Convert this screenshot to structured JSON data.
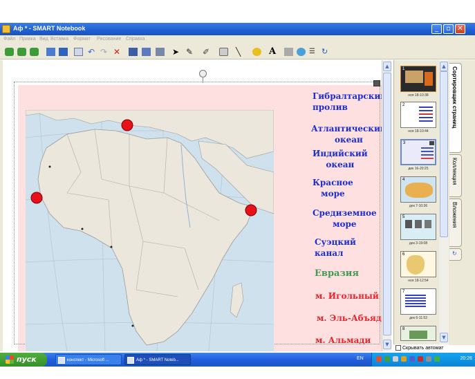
{
  "window": {
    "title": "Аф * - SMART Notebook",
    "min_glyph": "_",
    "max_glyph": "▫",
    "close_glyph": "✕"
  },
  "menu": [
    "Файл",
    "Правка",
    "Вид",
    "Вставка",
    "Формат",
    "Рисование",
    "Справка"
  ],
  "labels": {
    "gibraltar": [
      "Гибралтарский",
      "пролив"
    ],
    "atlantic": [
      "Атлантический",
      "океан"
    ],
    "indian": [
      "Индийский",
      "океан"
    ],
    "red_sea": [
      "Красное",
      "море"
    ],
    "mediterranean": [
      "Средиземное",
      "море"
    ],
    "suez": [
      "Суэцкий",
      "канал"
    ],
    "eurasia": "Евразия",
    "cape_agulhas": "м. Игольный",
    "cape_ben_sekka": "м. Эль-Абъяд",
    "cape_almadi": "м. Альмади"
  },
  "sorter": {
    "pages": [
      {
        "num": "1",
        "caption": "ноя 18-10:38"
      },
      {
        "num": "2",
        "caption": "ноя 18-10:44"
      },
      {
        "num": "3",
        "caption": "дек 16-20:25"
      },
      {
        "num": "4",
        "caption": "дек 7-10:36"
      },
      {
        "num": "5",
        "caption": "дек 3-19:08"
      },
      {
        "num": "6",
        "caption": "ноя 18-12:54"
      },
      {
        "num": "7",
        "caption": "дек 6-11:53"
      },
      {
        "num": "8",
        "caption": ""
      }
    ],
    "autohide": "Скрывать автомат"
  },
  "tabs": [
    "Сортировщик страниц",
    "Коллекция",
    "Вложения"
  ],
  "taskbar": {
    "start": "пуск",
    "tasks": [
      "конспект - Microsoft ...",
      "Аф * - SMART Noteb..."
    ],
    "lang": "EN",
    "clock": "20:26"
  },
  "colors": {
    "title_blue": "#1b2fd0",
    "eurasia_green": "#3f9a52",
    "cape_red": "#e8252b",
    "marker_red": "#e8101a",
    "slide_pink": "#ffe0e0"
  }
}
